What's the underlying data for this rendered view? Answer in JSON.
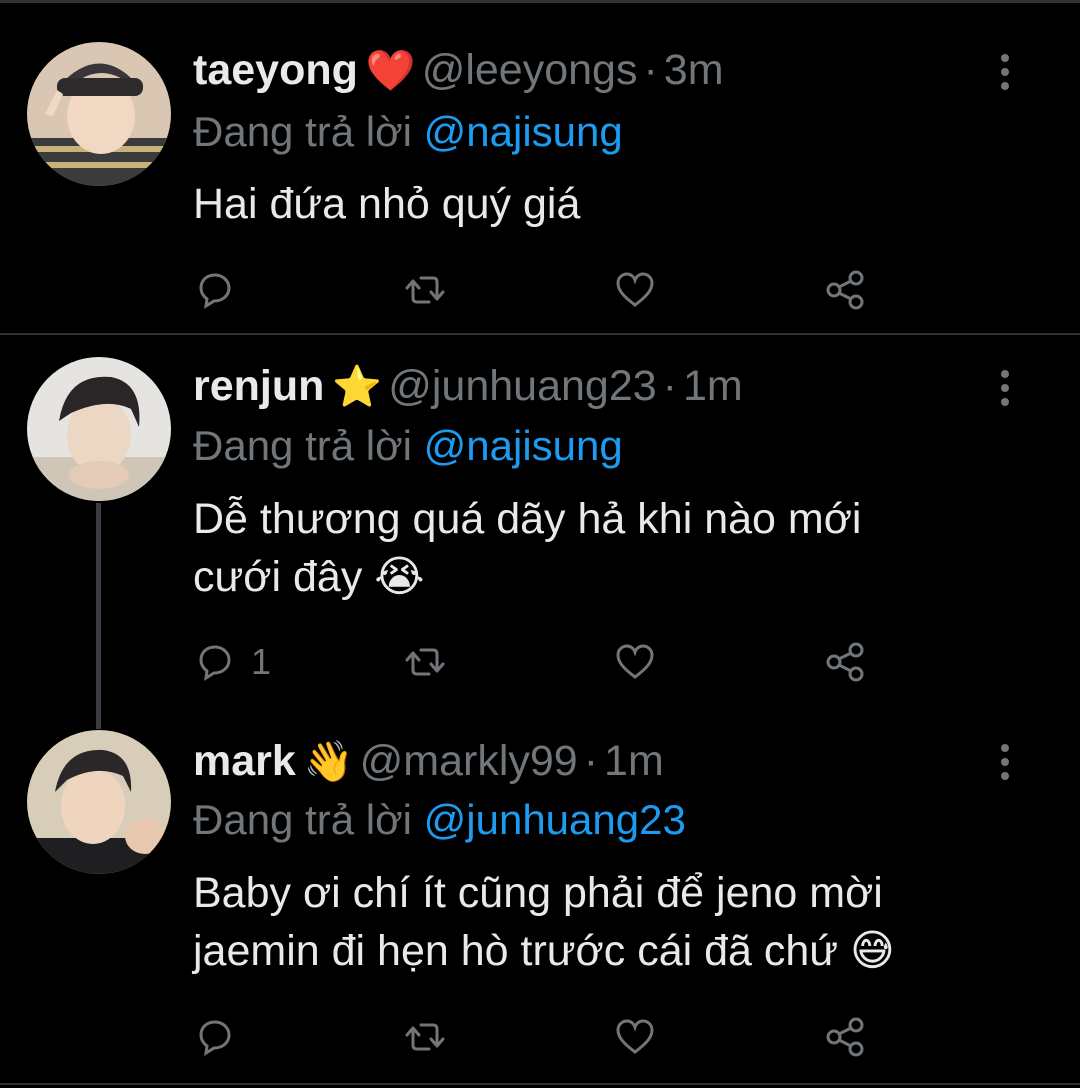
{
  "replies": [
    {
      "name": "taeyong",
      "badge": "❤️",
      "handle": "@leeyongs",
      "separator": "·",
      "time": "3m",
      "replying_label": "Đang trả lời",
      "replying_to": "@najisung",
      "text_lines": [
        "Hai đứa nhỏ quý giá"
      ],
      "reply_count": ""
    },
    {
      "name": "renjun",
      "badge": "⭐",
      "handle": "@junhuang23",
      "separator": "·",
      "time": "1m",
      "replying_label": "Đang trả lời",
      "replying_to": "@najisung",
      "text_lines": [
        "Dễ thương quá dãy hả khi nào mới",
        "cưới đây 😭"
      ],
      "reply_count": "1"
    },
    {
      "name": "mark",
      "badge": "👋",
      "handle": "@markly99",
      "separator": "·",
      "time": "1m",
      "replying_label": "Đang trả lời",
      "replying_to": "@junhuang23",
      "text_lines": [
        "Baby ơi chí ít cũng phải để jeno mời",
        "jaemin đi hẹn hò trước cái đã chứ 😅"
      ],
      "reply_count": ""
    }
  ],
  "colors": {
    "background": "#000000",
    "muted": "#71767b",
    "link": "#1d9bf0",
    "divider": "#2f3336"
  },
  "icons": [
    "reply-icon",
    "retweet-icon",
    "like-icon",
    "share-icon",
    "more-icon"
  ]
}
